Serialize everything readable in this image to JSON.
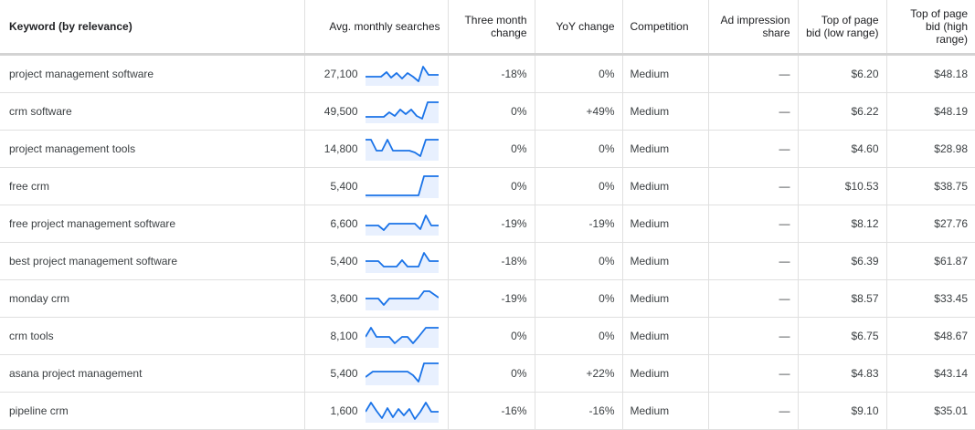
{
  "headers": {
    "keyword": "Keyword (by relevance)",
    "avg": "Avg. monthly searches",
    "three_month": "Three month change",
    "yoy": "YoY change",
    "competition": "Competition",
    "ad_impression": "Ad impression share",
    "bid_low": "Top of page bid (low range)",
    "bid_high": "Top of page bid (high range)"
  },
  "colors": {
    "spark_line": "#1a73e8",
    "spark_fill": "#e8f0fe"
  },
  "rows": [
    {
      "keyword": "project management software",
      "avg": "27,100",
      "three_month": "-18%",
      "yoy": "0%",
      "competition": "Medium",
      "ad_impression": "—",
      "bid_low": "$6.20",
      "bid_high": "$48.18"
    },
    {
      "keyword": "crm software",
      "avg": "49,500",
      "three_month": "0%",
      "yoy": "+49%",
      "competition": "Medium",
      "ad_impression": "—",
      "bid_low": "$6.22",
      "bid_high": "$48.19"
    },
    {
      "keyword": "project management tools",
      "avg": "14,800",
      "three_month": "0%",
      "yoy": "0%",
      "competition": "Medium",
      "ad_impression": "—",
      "bid_low": "$4.60",
      "bid_high": "$28.98"
    },
    {
      "keyword": "free crm",
      "avg": "5,400",
      "three_month": "0%",
      "yoy": "0%",
      "competition": "Medium",
      "ad_impression": "—",
      "bid_low": "$10.53",
      "bid_high": "$38.75"
    },
    {
      "keyword": "free project management software",
      "avg": "6,600",
      "three_month": "-19%",
      "yoy": "-19%",
      "competition": "Medium",
      "ad_impression": "—",
      "bid_low": "$8.12",
      "bid_high": "$27.76"
    },
    {
      "keyword": "best project management software",
      "avg": "5,400",
      "three_month": "-18%",
      "yoy": "0%",
      "competition": "Medium",
      "ad_impression": "—",
      "bid_low": "$6.39",
      "bid_high": "$61.87"
    },
    {
      "keyword": "monday crm",
      "avg": "3,600",
      "three_month": "-19%",
      "yoy": "0%",
      "competition": "Medium",
      "ad_impression": "—",
      "bid_low": "$8.57",
      "bid_high": "$33.45"
    },
    {
      "keyword": "crm tools",
      "avg": "8,100",
      "three_month": "0%",
      "yoy": "0%",
      "competition": "Medium",
      "ad_impression": "—",
      "bid_low": "$6.75",
      "bid_high": "$48.67"
    },
    {
      "keyword": "asana project management",
      "avg": "5,400",
      "three_month": "0%",
      "yoy": "+22%",
      "competition": "Medium",
      "ad_impression": "—",
      "bid_low": "$4.83",
      "bid_high": "$43.14"
    },
    {
      "keyword": "pipeline crm",
      "avg": "1,600",
      "three_month": "-16%",
      "yoy": "-16%",
      "competition": "Medium",
      "ad_impression": "—",
      "bid_low": "$9.10",
      "bid_high": "$35.01"
    }
  ]
}
